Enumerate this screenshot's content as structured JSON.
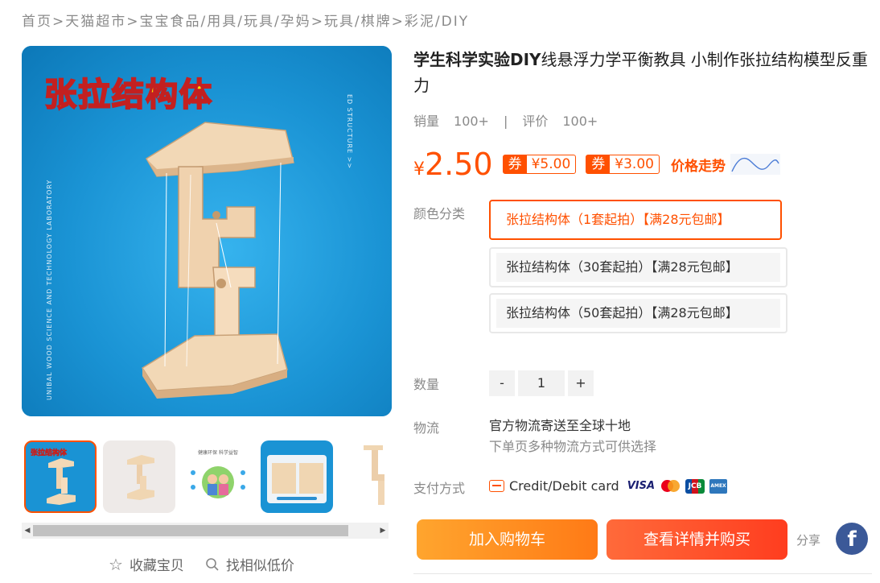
{
  "breadcrumb": {
    "items": [
      "首页",
      "天猫超市",
      "宝宝食品/用具/玩具/孕妈",
      "玩具/棋牌",
      "彩泥/DIY"
    ],
    "separator": ">"
  },
  "gallery": {
    "main_title_art": "张拉结构体",
    "side_text_right": "ED STRUCTURE >>",
    "side_text_left": "UNIBAL WOOD SCIENCE AND TECHNOLOGY LABORATORY",
    "thumbnail_count": 5,
    "thumbnail_1_art": "张拉结构体",
    "thumbnail_3_art": "健康环保 科学益智",
    "actions": {
      "favorite": "收藏宝贝",
      "similar": "找相似低价"
    }
  },
  "product": {
    "title_bold": "学生科学实验DIY",
    "title_rest": "线悬浮力学平衡教具 小制作张拉结构模型反重力",
    "sales_label": "销量",
    "sales_value": "100+",
    "sales_sep": "|",
    "review_label": "评价",
    "review_value": "100+",
    "currency": "¥",
    "price": "2.50",
    "coupons": [
      {
        "tag": "券",
        "amount": "¥5.00"
      },
      {
        "tag": "券",
        "amount": "¥3.00"
      }
    ],
    "price_trend_label": "价格走势"
  },
  "options": {
    "color_label": "颜色分类",
    "skus": [
      {
        "label": "张拉结构体（1套起拍）【满28元包邮】",
        "selected": true
      },
      {
        "label": "张拉结构体（30套起拍）【满28元包邮】",
        "selected": false
      },
      {
        "label": "张拉结构体（50套起拍）【满28元包邮】",
        "selected": false
      }
    ],
    "quantity_label": "数量",
    "quantity_minus": "-",
    "quantity_value": "1",
    "quantity_plus": "+"
  },
  "logistics": {
    "label": "物流",
    "line1": "官方物流寄送至全球十地",
    "line2": "下单页多种物流方式可供选择"
  },
  "payment": {
    "label": "支付方式",
    "method": "Credit/Debit card",
    "brands": [
      "VISA",
      "mastercard",
      "JCB",
      "AMEX"
    ]
  },
  "actions": {
    "add_to_cart": "加入购物车",
    "buy_now": "查看详情并购买",
    "share_label": "分享",
    "facebook": "f"
  },
  "colors": {
    "accent": "#ff5000",
    "cart_gradient": [
      "#ffa52e",
      "#ff7a16"
    ],
    "buy_gradient": [
      "#ff6a3a",
      "#ff3d1f"
    ],
    "facebook": "#3b5998"
  }
}
